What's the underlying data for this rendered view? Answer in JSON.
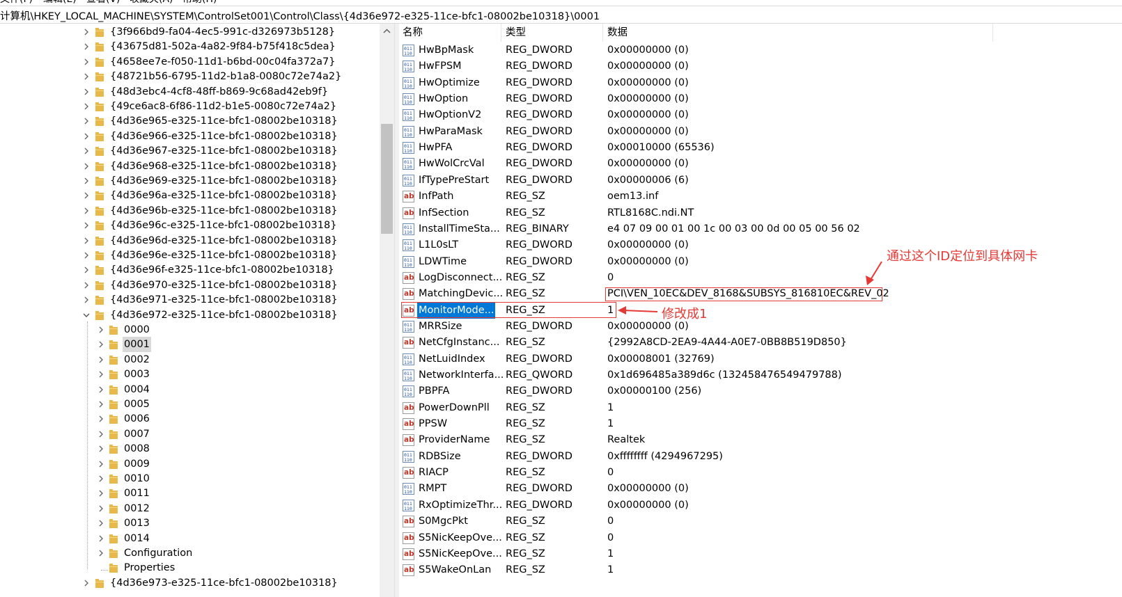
{
  "menubar": {
    "items": [
      "文件(F)",
      "编辑(E)",
      "查看(V)",
      "收藏夹(A)",
      "帮助(H)"
    ]
  },
  "address": {
    "path": "计算机\\HKEY_LOCAL_MACHINE\\SYSTEM\\ControlSet001\\Control\\Class\\{4d36e972-e325-11ce-bfc1-08002be10318}\\0001"
  },
  "tree": {
    "items": [
      {
        "label": "{3f966bd9-fa04-4ec5-991c-d326973b5128}"
      },
      {
        "label": "{43675d81-502a-4a82-9f84-b75f418c5dea}"
      },
      {
        "label": "{4658ee7e-f050-11d1-b6bd-00c04fa372a7}"
      },
      {
        "label": "{48721b56-6795-11d2-b1a8-0080c72e74a2}"
      },
      {
        "label": "{48d3ebc4-4cf8-48ff-b869-9c68ad42eb9f}"
      },
      {
        "label": "{49ce6ac8-6f86-11d2-b1e5-0080c72e74a2}"
      },
      {
        "label": "{4d36e965-e325-11ce-bfc1-08002be10318}"
      },
      {
        "label": "{4d36e966-e325-11ce-bfc1-08002be10318}"
      },
      {
        "label": "{4d36e967-e325-11ce-bfc1-08002be10318}"
      },
      {
        "label": "{4d36e968-e325-11ce-bfc1-08002be10318}"
      },
      {
        "label": "{4d36e969-e325-11ce-bfc1-08002be10318}"
      },
      {
        "label": "{4d36e96a-e325-11ce-bfc1-08002be10318}"
      },
      {
        "label": "{4d36e96b-e325-11ce-bfc1-08002be10318}"
      },
      {
        "label": "{4d36e96c-e325-11ce-bfc1-08002be10318}"
      },
      {
        "label": "{4d36e96d-e325-11ce-bfc1-08002be10318}"
      },
      {
        "label": "{4d36e96e-e325-11ce-bfc1-08002be10318}"
      },
      {
        "label": "{4d36e96f-e325-11ce-bfc1-08002be10318}"
      },
      {
        "label": "{4d36e970-e325-11ce-bfc1-08002be10318}"
      },
      {
        "label": "{4d36e971-e325-11ce-bfc1-08002be10318}"
      },
      {
        "label": "{4d36e972-e325-11ce-bfc1-08002be10318}"
      },
      {
        "label": "0000"
      },
      {
        "label": "0001"
      },
      {
        "label": "0002"
      },
      {
        "label": "0003"
      },
      {
        "label": "0004"
      },
      {
        "label": "0005"
      },
      {
        "label": "0006"
      },
      {
        "label": "0007"
      },
      {
        "label": "0008"
      },
      {
        "label": "0009"
      },
      {
        "label": "0010"
      },
      {
        "label": "0011"
      },
      {
        "label": "0012"
      },
      {
        "label": "0013"
      },
      {
        "label": "0014"
      },
      {
        "label": "Configuration"
      },
      {
        "label": "Properties"
      },
      {
        "label": "{4d36e973-e325-11ce-bfc1-08002be10318}"
      }
    ]
  },
  "values": {
    "headers": {
      "name": "名称",
      "type": "类型",
      "data": "数据"
    },
    "rows": [
      {
        "name": "HwBpMask",
        "type": "REG_DWORD",
        "data": "0x00000000 (0)",
        "icon": "binary-value-icon"
      },
      {
        "name": "HwFPSM",
        "type": "REG_DWORD",
        "data": "0x00000000 (0)",
        "icon": "binary-value-icon"
      },
      {
        "name": "HwOptimize",
        "type": "REG_DWORD",
        "data": "0x00000000 (0)",
        "icon": "binary-value-icon"
      },
      {
        "name": "HwOption",
        "type": "REG_DWORD",
        "data": "0x00000000 (0)",
        "icon": "binary-value-icon"
      },
      {
        "name": "HwOptionV2",
        "type": "REG_DWORD",
        "data": "0x00000000 (0)",
        "icon": "binary-value-icon"
      },
      {
        "name": "HwParaMask",
        "type": "REG_DWORD",
        "data": "0x00000000 (0)",
        "icon": "binary-value-icon"
      },
      {
        "name": "HwPFA",
        "type": "REG_DWORD",
        "data": "0x00010000 (65536)",
        "icon": "binary-value-icon"
      },
      {
        "name": "HwWolCrcVal",
        "type": "REG_DWORD",
        "data": "0x00000000 (0)",
        "icon": "binary-value-icon"
      },
      {
        "name": "IfTypePreStart",
        "type": "REG_DWORD",
        "data": "0x00000006 (6)",
        "icon": "binary-value-icon"
      },
      {
        "name": "InfPath",
        "type": "REG_SZ",
        "data": "oem13.inf",
        "icon": "string-value-icon"
      },
      {
        "name": "InfSection",
        "type": "REG_SZ",
        "data": "RTL8168C.ndi.NT",
        "icon": "string-value-icon"
      },
      {
        "name": "InstallTimeSta...",
        "type": "REG_BINARY",
        "data": "e4 07 09 00 01 00 1c 00 03 00 0d 00 05 00 56 02",
        "icon": "binary-value-icon"
      },
      {
        "name": "L1L0sLT",
        "type": "REG_DWORD",
        "data": "0x00000000 (0)",
        "icon": "binary-value-icon"
      },
      {
        "name": "LDWTime",
        "type": "REG_DWORD",
        "data": "0x00000000 (0)",
        "icon": "binary-value-icon"
      },
      {
        "name": "LogDisconnect...",
        "type": "REG_SZ",
        "data": "0",
        "icon": "string-value-icon"
      },
      {
        "name": "MatchingDevic...",
        "type": "REG_SZ",
        "data": "PCI\\VEN_10EC&DEV_8168&SUBSYS_816810EC&REV_02",
        "icon": "string-value-icon"
      },
      {
        "name": "MonitorMode...",
        "type": "REG_SZ",
        "data": "1",
        "icon": "string-value-icon"
      },
      {
        "name": "MRRSize",
        "type": "REG_DWORD",
        "data": "0x00000000 (0)",
        "icon": "binary-value-icon"
      },
      {
        "name": "NetCfgInstanc...",
        "type": "REG_SZ",
        "data": "{2992A8CD-2EA9-4A44-A0E7-0BB8B519D850}",
        "icon": "string-value-icon"
      },
      {
        "name": "NetLuidIndex",
        "type": "REG_DWORD",
        "data": "0x00008001 (32769)",
        "icon": "binary-value-icon"
      },
      {
        "name": "NetworkInterfa...",
        "type": "REG_QWORD",
        "data": "0x1d696485a389d6c (132458476549479788)",
        "icon": "binary-value-icon"
      },
      {
        "name": "PBPFA",
        "type": "REG_DWORD",
        "data": "0x00000100 (256)",
        "icon": "binary-value-icon"
      },
      {
        "name": "PowerDownPll",
        "type": "REG_SZ",
        "data": "1",
        "icon": "string-value-icon"
      },
      {
        "name": "PPSW",
        "type": "REG_SZ",
        "data": "1",
        "icon": "string-value-icon"
      },
      {
        "name": "ProviderName",
        "type": "REG_SZ",
        "data": "Realtek",
        "icon": "string-value-icon"
      },
      {
        "name": "RDBSize",
        "type": "REG_DWORD",
        "data": "0xffffffff (4294967295)",
        "icon": "binary-value-icon"
      },
      {
        "name": "RIACP",
        "type": "REG_SZ",
        "data": "0",
        "icon": "string-value-icon"
      },
      {
        "name": "RMPT",
        "type": "REG_DWORD",
        "data": "0x00000000 (0)",
        "icon": "binary-value-icon"
      },
      {
        "name": "RxOptimizeThr...",
        "type": "REG_DWORD",
        "data": "0x00000000 (0)",
        "icon": "binary-value-icon"
      },
      {
        "name": "S0MgcPkt",
        "type": "REG_SZ",
        "data": "0",
        "icon": "string-value-icon"
      },
      {
        "name": "S5NicKeepOve...",
        "type": "REG_SZ",
        "data": "0",
        "icon": "string-value-icon"
      },
      {
        "name": "S5NicKeepOve...",
        "type": "REG_SZ",
        "data": "1",
        "icon": "string-value-icon"
      },
      {
        "name": "S5WakeOnLan",
        "type": "REG_SZ",
        "data": "1",
        "icon": "string-value-icon"
      }
    ]
  },
  "annotations": {
    "locate_note": "通过这个ID定位到具体网卡",
    "modify_note": "修改成1"
  },
  "colors": {
    "selection": "#0078d7",
    "annotation": "#e53935",
    "folder": "#e8b94a"
  }
}
